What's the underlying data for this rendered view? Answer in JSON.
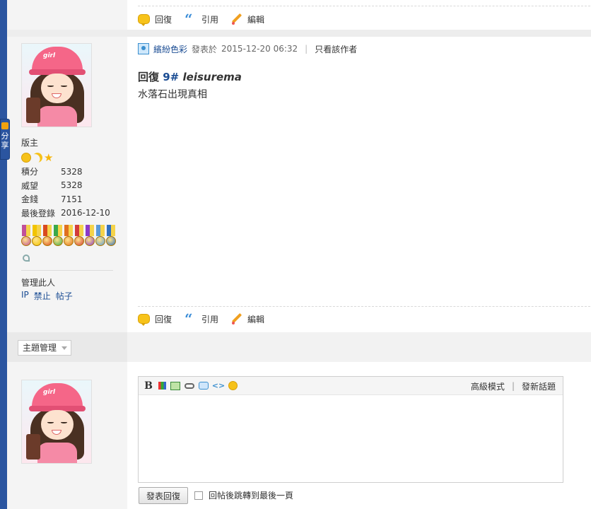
{
  "share_tab": {
    "label": "分享"
  },
  "post_actions": {
    "reply": "回復",
    "quote": "引用",
    "edit": "編輯"
  },
  "post": {
    "author": "繽紛色彩",
    "posted_label": "發表於",
    "posted_time": "2015-12-20 06:32",
    "only_author": "只看該作者",
    "title_prefix": "回復",
    "floor": "9#",
    "quoted_user": "leisurema",
    "body": "水落石出現真相"
  },
  "user": {
    "avatar_text": "girl",
    "role": "版主",
    "stats": [
      {
        "label": "積分",
        "value": "5328"
      },
      {
        "label": "威望",
        "value": "5328"
      },
      {
        "label": "金錢",
        "value": "7151"
      },
      {
        "label": "最後登錄",
        "value": "2016-12-10"
      }
    ],
    "manage_title": "管理此人",
    "manage_links": [
      "IP",
      "禁止",
      "帖子"
    ]
  },
  "medal_colors": [
    "#c0509a",
    "#f2c400",
    "#d94a1f",
    "#3aa84a",
    "#e07020",
    "#d23b3b",
    "#8a3ac9",
    "#5a9ad8",
    "#2f6fc0"
  ],
  "topic_manage": {
    "label": "主題管理"
  },
  "reply_user": {
    "avatar_text": "girl"
  },
  "editor": {
    "advanced_mode": "高級模式",
    "new_topic": "發新話題",
    "content": ""
  },
  "submit": {
    "label": "發表回復"
  },
  "jump_option": {
    "label": "回帖後跳轉到最後一頁"
  }
}
